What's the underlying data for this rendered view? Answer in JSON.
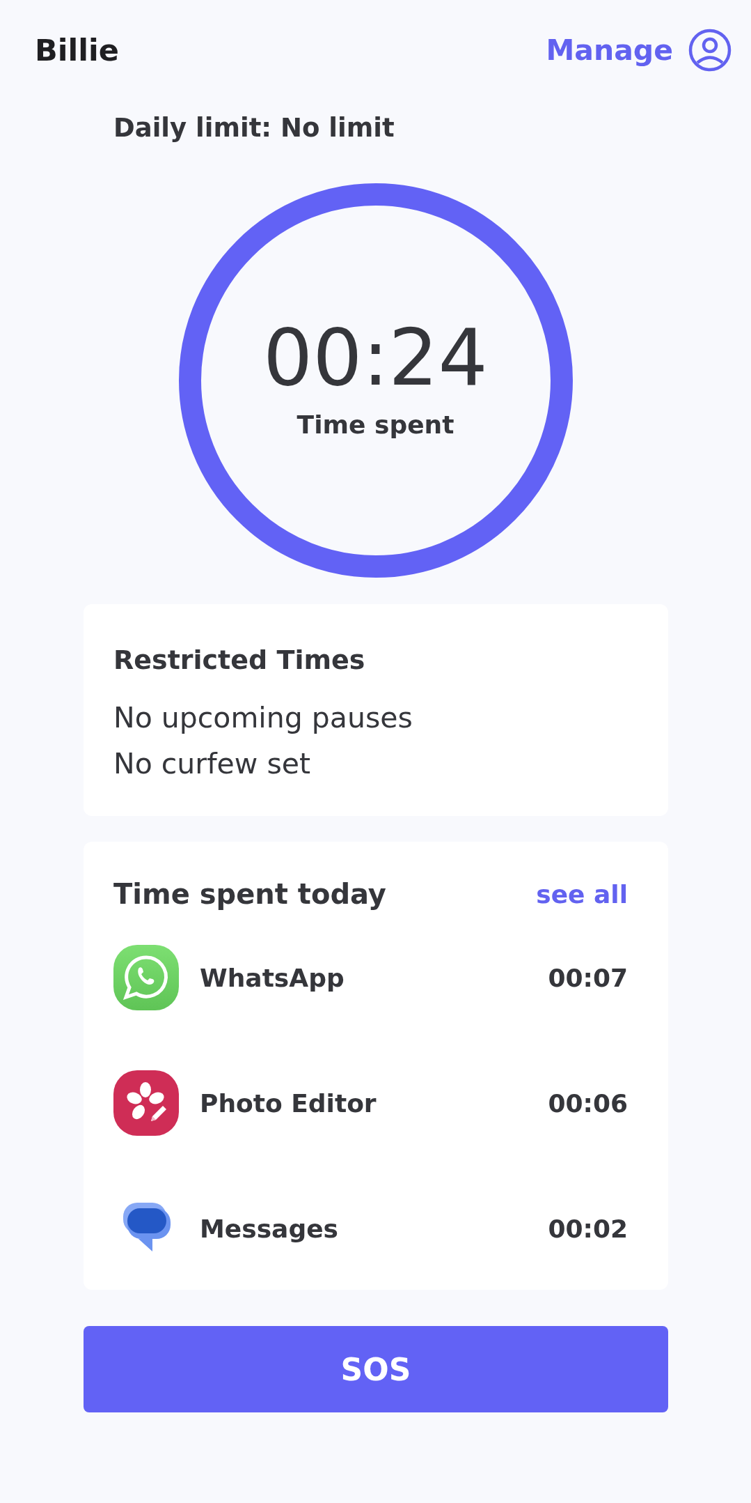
{
  "header": {
    "title": "Billie",
    "manage": "Manage"
  },
  "daily_limit": "Daily limit: No limit",
  "timer": {
    "time": "00:24",
    "label": "Time spent"
  },
  "restricted_times": {
    "title": "Restricted Times",
    "lines": [
      "No upcoming pauses",
      "No curfew set"
    ]
  },
  "time_spent_today": {
    "title": "Time spent today",
    "see_all": "see all",
    "apps": [
      {
        "name": "WhatsApp",
        "time": "00:07",
        "kind": "phone"
      },
      {
        "name": "Photo Editor",
        "time": "00:06",
        "kind": "flower"
      },
      {
        "name": "Messages",
        "time": "00:02",
        "kind": "chat"
      }
    ]
  },
  "sos_button": "SOS"
}
